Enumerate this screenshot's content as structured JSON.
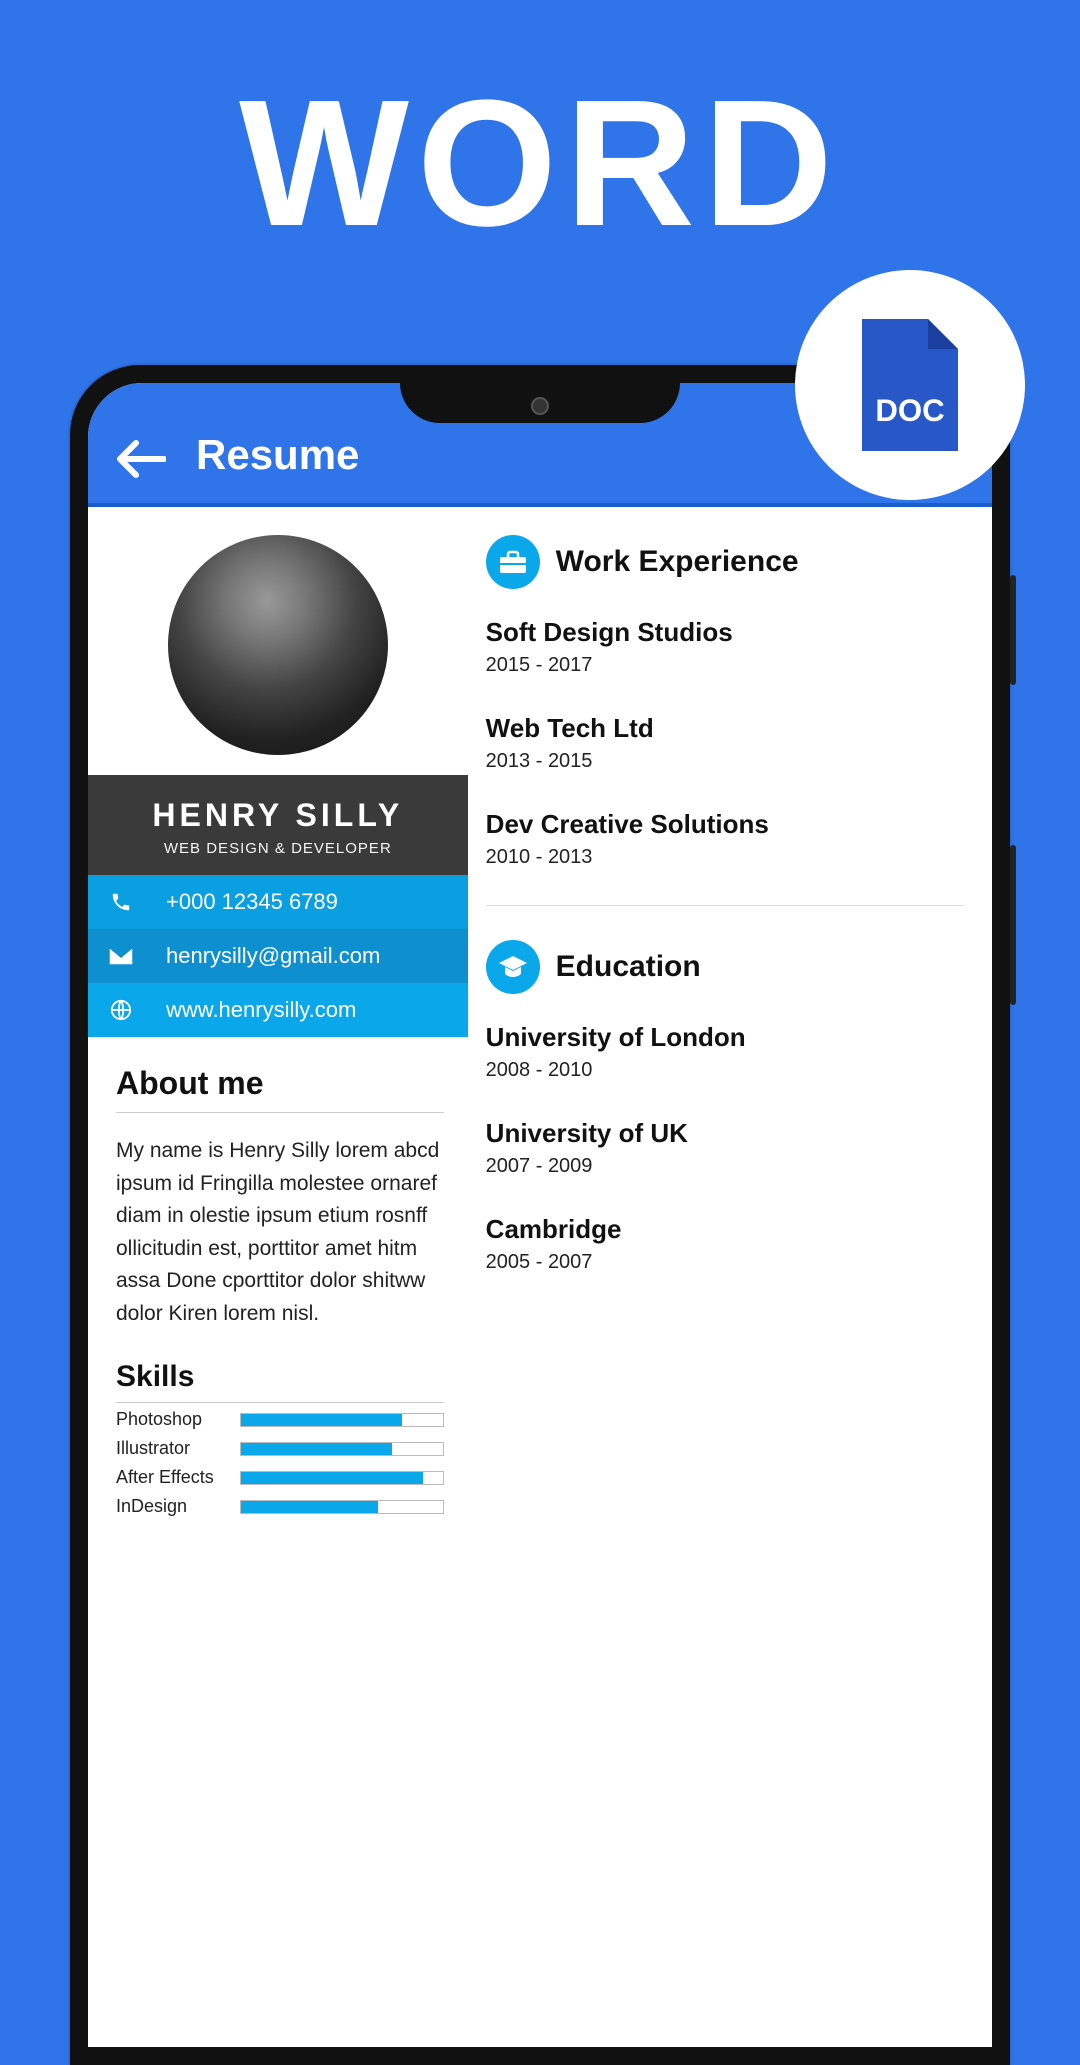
{
  "hero": {
    "title": "WORD",
    "badge_label": "DOC"
  },
  "app": {
    "title": "Resume"
  },
  "profile": {
    "name": "HENRY SILLY",
    "role": "WEB DESIGN & DEVELOPER"
  },
  "contact": {
    "phone": "+000 12345 6789",
    "email": "henrysilly@gmail.com",
    "website": "www.henrysilly.com"
  },
  "about": {
    "heading": "About me",
    "text": "My name is Henry Silly lorem abcd ipsum id Fringilla molestee ornaref diam in olestie ipsum etium rosnff ollicitudin est, porttitor amet hitm assa Done cporttitor dolor shitww dolor Kiren lorem nisl."
  },
  "skills": {
    "heading": "Skills",
    "items": [
      {
        "label": "Photoshop",
        "percent": 80
      },
      {
        "label": "Illustrator",
        "percent": 75
      },
      {
        "label": "After Effects",
        "percent": 90
      },
      {
        "label": "InDesign",
        "percent": 68
      }
    ]
  },
  "work": {
    "heading": "Work Experience",
    "items": [
      {
        "title": "Soft Design Studios",
        "dates": "2015 - 2017"
      },
      {
        "title": "Web Tech Ltd",
        "dates": "2013 - 2015"
      },
      {
        "title": "Dev Creative Solutions",
        "dates": "2010 - 2013"
      }
    ]
  },
  "education": {
    "heading": "Education",
    "items": [
      {
        "title": "University of London",
        "dates": "2008 - 2010"
      },
      {
        "title": "University of UK",
        "dates": "2007 - 2009"
      },
      {
        "title": "Cambridge",
        "dates": "2005 - 2007"
      }
    ]
  }
}
